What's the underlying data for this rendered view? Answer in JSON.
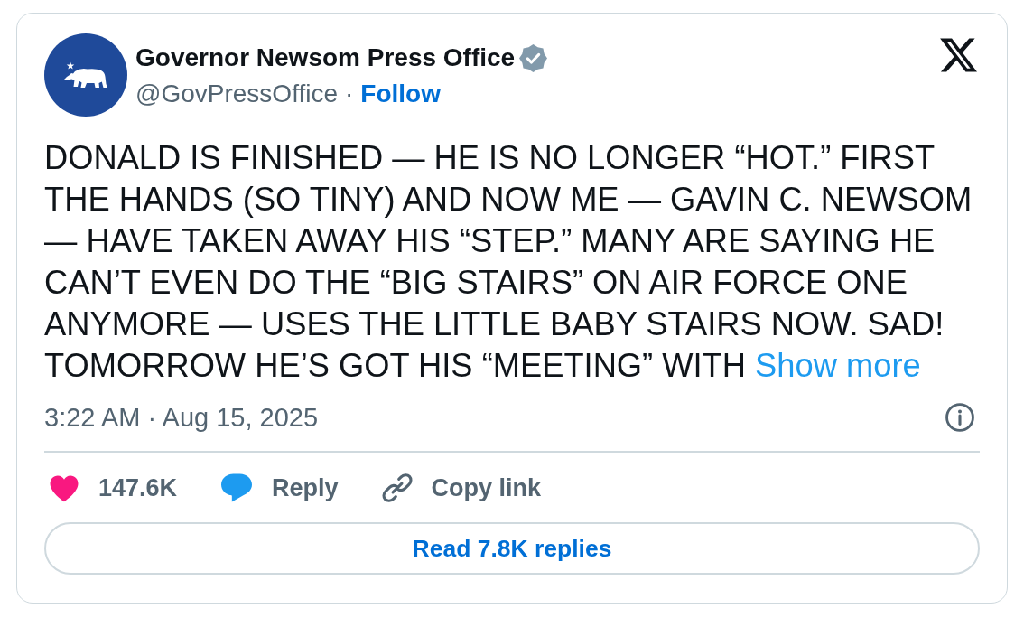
{
  "tweet": {
    "author": {
      "name": "Governor Newsom Press Office",
      "verified": true,
      "handle": "@GovPressOffice",
      "separator": "·",
      "follow_label": "Follow"
    },
    "text": "DONALD IS FINISHED — HE IS NO LONGER “HOT.” FIRST THE HANDS (SO TINY) AND NOW ME — GAVIN C. NEWSOM — HAVE TAKEN AWAY HIS “STEP.” MANY ARE SAYING HE CAN’T EVEN DO THE “BIG STAIRS” ON AIR FORCE ONE ANYMORE — USES THE LITTLE BABY STAIRS NOW. SAD! TOMORROW HE’S GOT HIS “MEETING” WITH",
    "show_more_label": "Show more",
    "timestamp": "3:22 AM · Aug 15, 2025",
    "actions": [
      {
        "kind": "like",
        "label": "147.6K"
      },
      {
        "kind": "reply",
        "label": "Reply"
      },
      {
        "kind": "copy_link",
        "label": "Copy link"
      }
    ],
    "read_replies_label": "Read 7.8K replies"
  }
}
